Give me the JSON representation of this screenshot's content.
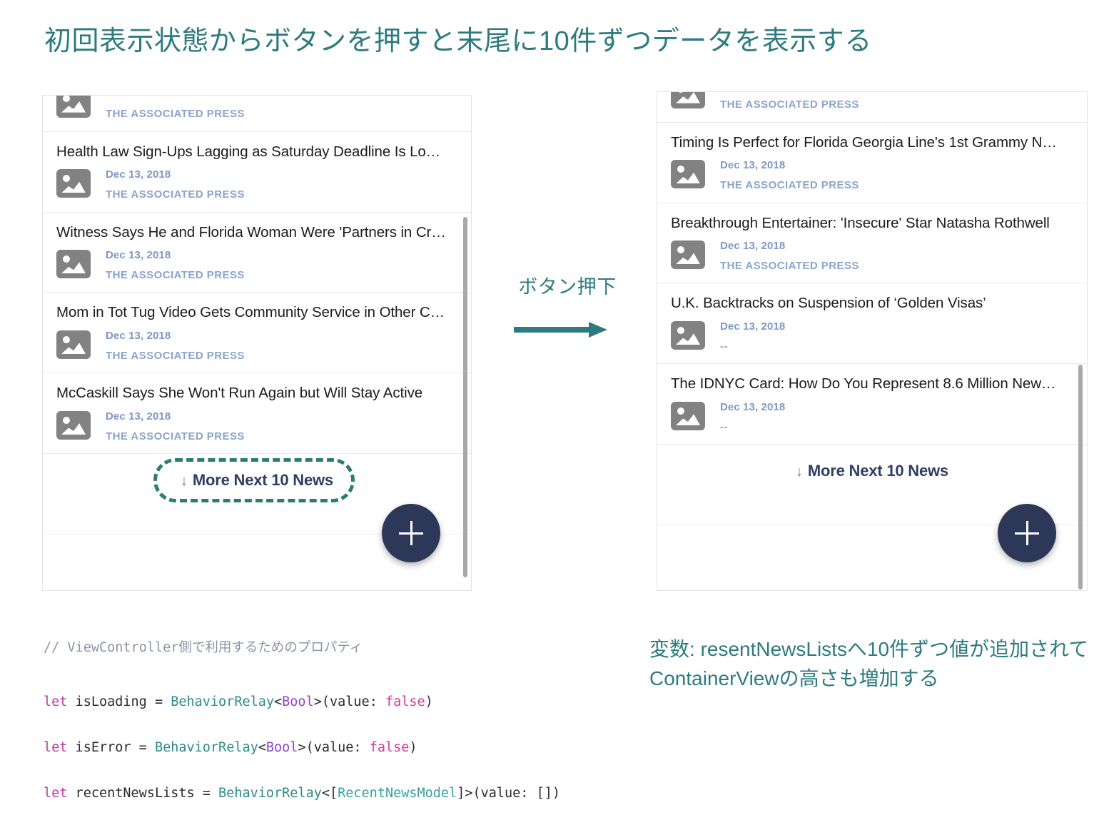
{
  "title": "初回表示状態からボタンを押すと末尾に10件ずつデータを表示する",
  "center": {
    "label": "ボタン押下",
    "arrow_icon": "arrow-right-icon"
  },
  "left_panel": {
    "partial_top_item": {
      "source": "THE ASSOCIATED PRESS"
    },
    "items": [
      {
        "title": "Health Law Sign-Ups Lagging as Saturday Deadline Is Lo…",
        "date": "Dec 13, 2018",
        "source": "THE ASSOCIATED PRESS"
      },
      {
        "title": "Witness Says He and Florida Woman Were 'Partners in Cr…",
        "date": "Dec 13, 2018",
        "source": "THE ASSOCIATED PRESS"
      },
      {
        "title": "Mom in Tot Tug Video Gets Community Service in Other C…",
        "date": "Dec 13, 2018",
        "source": "THE ASSOCIATED PRESS"
      },
      {
        "title": "McCaskill Says She Won't Run Again but Will Stay Active",
        "date": "Dec 13, 2018",
        "source": "THE ASSOCIATED PRESS"
      }
    ],
    "more_button": {
      "arrow": "↓",
      "label": "More Next 10 News",
      "highlighted": true
    },
    "fab": {
      "icon": "plus-icon"
    }
  },
  "right_panel": {
    "partial_top_item": {
      "source": "THE ASSOCIATED PRESS"
    },
    "items": [
      {
        "title": "Timing Is Perfect for Florida Georgia Line's 1st Grammy N…",
        "date": "Dec 13, 2018",
        "source": "THE ASSOCIATED PRESS"
      },
      {
        "title": "Breakthrough Entertainer: 'Insecure' Star Natasha Rothwell",
        "date": "Dec 13, 2018",
        "source": "THE ASSOCIATED PRESS"
      },
      {
        "title": "U.K. Backtracks on Suspension of ‘Golden Visas’",
        "date": "Dec 13, 2018",
        "source": "--"
      },
      {
        "title": "The IDNYC Card: How Do You Represent 8.6 Million New…",
        "date": "Dec 13, 2018",
        "source": "--"
      }
    ],
    "more_button": {
      "arrow": "↓",
      "label": "More Next 10 News",
      "highlighted": false
    },
    "fab": {
      "icon": "plus-icon"
    }
  },
  "code": {
    "comment": "// ViewController側で利用するためのプロパティ",
    "line1": {
      "kw": "let",
      "name": " isLoading = ",
      "type": "BehaviorRelay",
      "lt": "<",
      "generic": "Bool",
      "gt": ">(value: ",
      "bool": "false",
      "end": ")"
    },
    "line2": {
      "kw": "let",
      "name": " isError = ",
      "type": "BehaviorRelay",
      "lt": "<",
      "generic": "Bool",
      "gt": ">(value: ",
      "bool": "false",
      "end": ")"
    },
    "line3": {
      "kw": "let",
      "name": " recentNewsLists = ",
      "type": "BehaviorRelay",
      "lt": "<[",
      "generic": "RecentNewsModel",
      "gt": "]>(value: [])"
    }
  },
  "note_right": "変数: resentNewsListsへ10件ずつ値が追加されてContainerViewの高さも増加する",
  "colors": {
    "accent_teal": "#2e7b7f",
    "highlight_teal": "#2d7d6e",
    "fab_navy": "#2d3859",
    "meta_blue": "#7e98c6",
    "more_label": "#2f3f63"
  }
}
